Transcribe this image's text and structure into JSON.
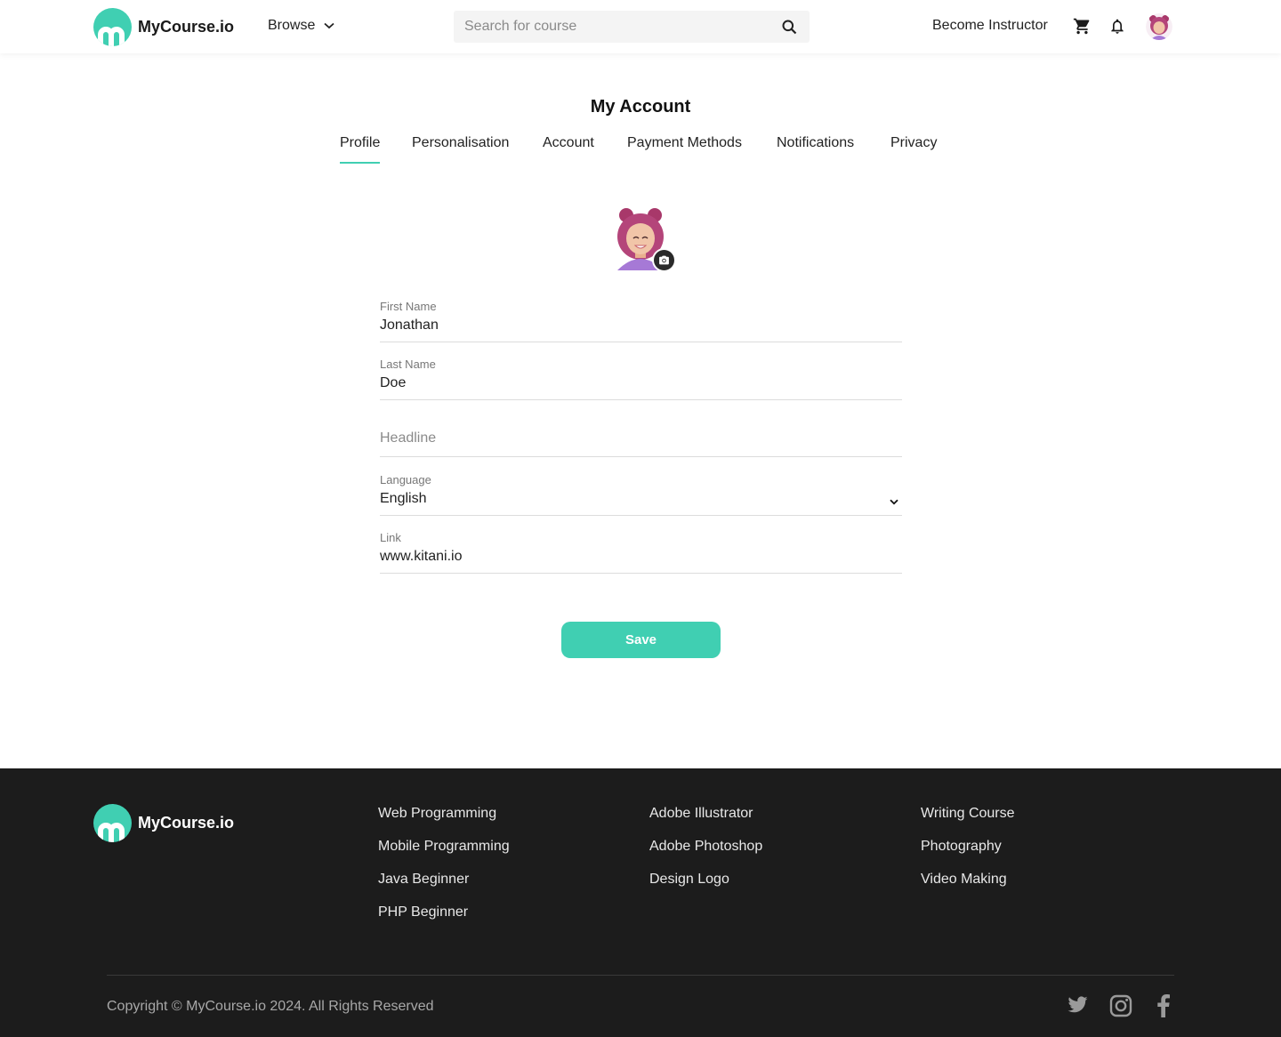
{
  "brand": {
    "name": "MyCourse.io",
    "accent_color": "#40cfb2"
  },
  "header": {
    "browse_label": "Browse",
    "search_placeholder": "Search for course",
    "become_instructor": "Become Instructor",
    "icons": [
      "cart-icon",
      "bell-icon",
      "avatar"
    ]
  },
  "page": {
    "title": "My Account",
    "tabs": [
      {
        "label": "Profile",
        "active": true
      },
      {
        "label": "Personalisation"
      },
      {
        "label": "Account"
      },
      {
        "label": "Payment Methods"
      },
      {
        "label": "Notifications"
      },
      {
        "label": "Privacy"
      }
    ]
  },
  "form": {
    "first_name": {
      "label": "First Name",
      "value": "Jonathan"
    },
    "last_name": {
      "label": "Last Name",
      "value": "Doe"
    },
    "headline": {
      "placeholder": "Headline"
    },
    "language": {
      "label": "Language",
      "value": "English"
    },
    "link": {
      "label": "Link",
      "value": "www.kitani.io"
    },
    "save_label": "Save"
  },
  "footer": {
    "columns": [
      [
        "Web Programming",
        "Mobile Programming",
        "Java Beginner",
        "PHP Beginner"
      ],
      [
        "Adobe Illustrator",
        "Adobe Photoshop",
        "Design Logo"
      ],
      [
        "Writing Course",
        "Photography",
        "Video Making"
      ]
    ],
    "copyright": "Copyright © MyCourse.io 2024. All Rights Reserved",
    "social": [
      "twitter-icon",
      "instagram-icon",
      "facebook-icon"
    ]
  }
}
